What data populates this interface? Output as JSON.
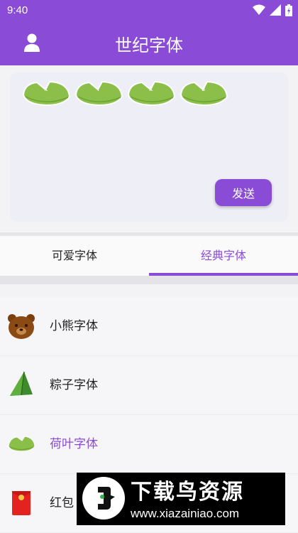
{
  "status": {
    "time": "9:40",
    "icons": [
      "wifi-icon",
      "signal-icon",
      "battery-icon"
    ]
  },
  "header": {
    "title": "世纪字体",
    "avatar_icon": "user-icon"
  },
  "composer": {
    "letters": [
      "x",
      "l",
      "k",
      "s"
    ],
    "send_label": "发送"
  },
  "tabs": [
    {
      "label": "可爱字体",
      "active": false
    },
    {
      "label": "经典字体",
      "active": true
    }
  ],
  "font_list": [
    {
      "label": "小熊字体",
      "icon": "bear-icon",
      "selected": false
    },
    {
      "label": "粽子字体",
      "icon": "zongzi-icon",
      "selected": false
    },
    {
      "label": "荷叶字体",
      "icon": "lotus-leaf-icon",
      "selected": true
    },
    {
      "label": "红包",
      "icon": "red-envelope-icon",
      "selected": false
    }
  ],
  "banner": {
    "title": "下载鸟资源",
    "url": "www.xiazainiao.com"
  },
  "colors": {
    "accent": "#8a4bd6",
    "leaf": "#8bbf4a"
  }
}
